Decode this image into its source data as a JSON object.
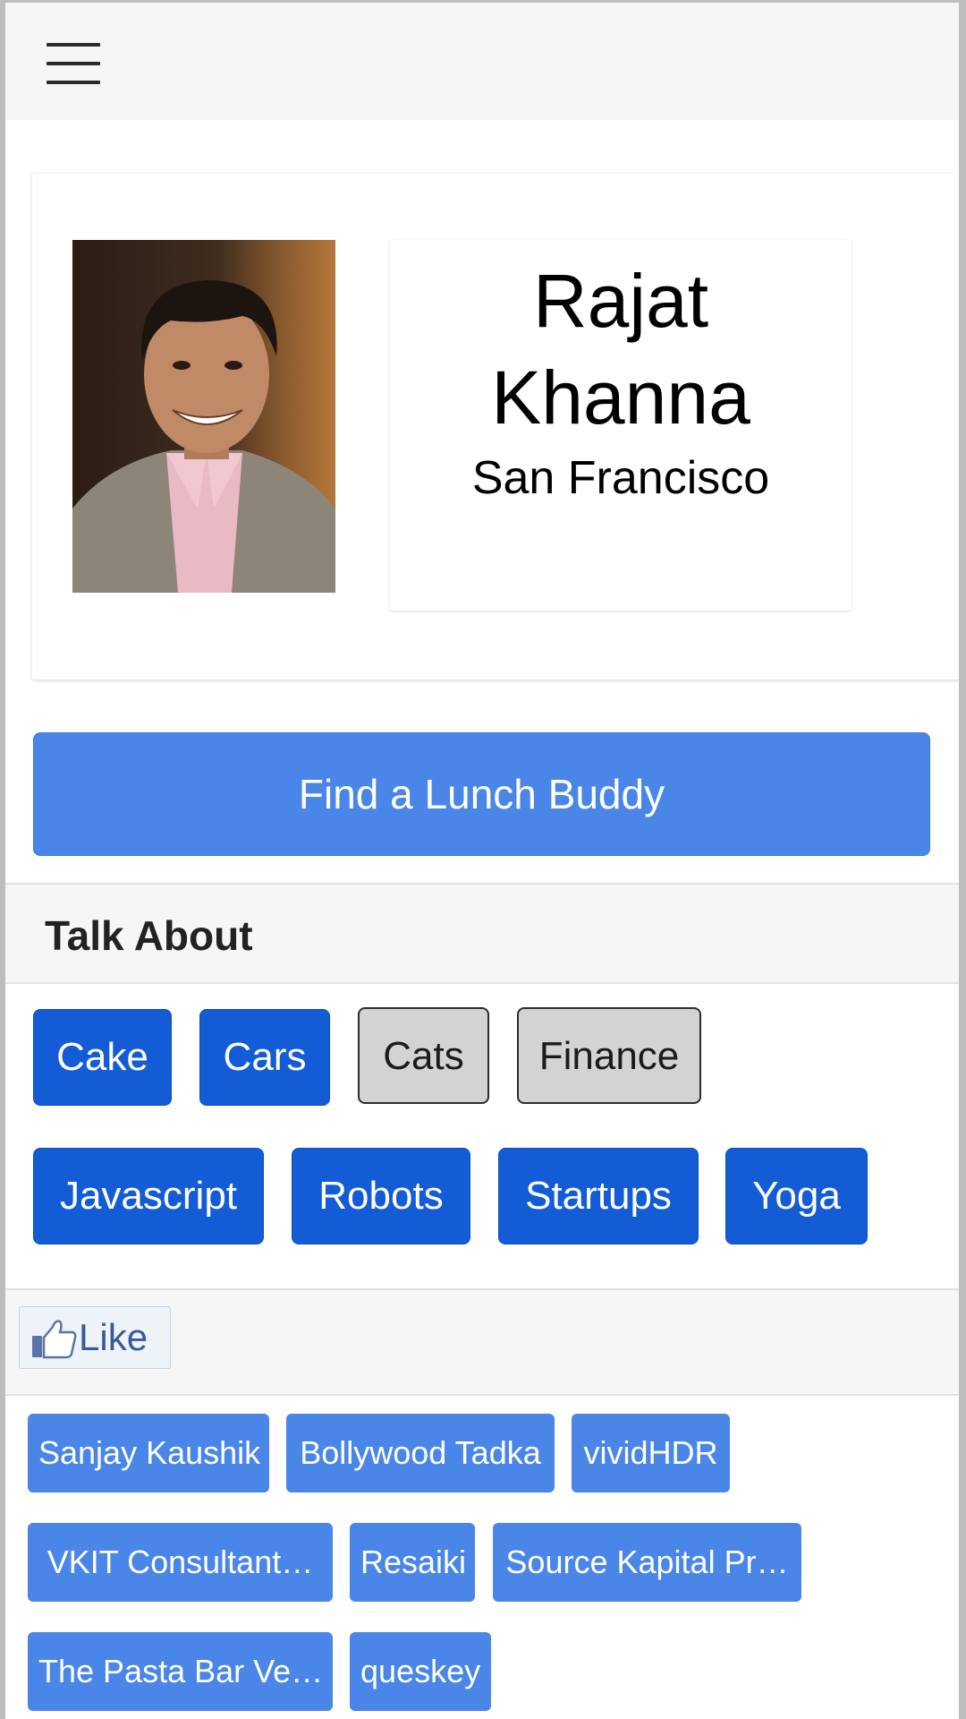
{
  "header": {
    "menu_icon": "hamburger-menu-icon"
  },
  "profile": {
    "name": "Rajat Khanna",
    "location": "San Francisco",
    "photo_alt": "profile-photo"
  },
  "primary_action": {
    "label": "Find a Lunch Buddy",
    "color": "#4a86e8"
  },
  "talk_about": {
    "title": "Talk About",
    "topics": [
      {
        "label": "Cake",
        "selected": true
      },
      {
        "label": "Cars",
        "selected": true
      },
      {
        "label": "Cats",
        "selected": false
      },
      {
        "label": "Finance",
        "selected": false
      },
      {
        "label": "Javascript",
        "selected": true
      },
      {
        "label": "Robots",
        "selected": true
      },
      {
        "label": "Startups",
        "selected": true
      },
      {
        "label": "Yoga",
        "selected": true
      }
    ],
    "selected_color": "#135cd6",
    "unselected_color": "#d3d3d3"
  },
  "likes": {
    "like_button_label": "Like",
    "like_icon": "thumbs-up-icon",
    "pages": [
      "Sanjay Kaushik",
      "Bollywood Tadka",
      "vividHDR",
      "VKIT Consultant…",
      "Resaiki",
      "Source Kapital Pr…",
      "The Pasta Bar Ve…",
      "queskey"
    ]
  }
}
